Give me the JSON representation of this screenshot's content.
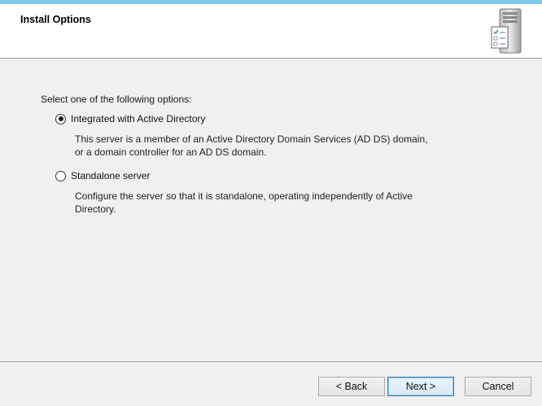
{
  "header": {
    "title": "Install Options",
    "icon": "server-checklist-icon"
  },
  "main": {
    "prompt": "Select one of the following options:",
    "options": [
      {
        "label": "Integrated with Active Directory",
        "selected": true,
        "description_lines": [
          "This server is a member of an Active Directory Domain Services (AD DS) domain,",
          "or a domain controller for an AD DS domain."
        ]
      },
      {
        "label": "Standalone server",
        "selected": false,
        "description_lines": [
          "Configure the server so that it is standalone, operating independently of Active",
          "Directory."
        ]
      }
    ]
  },
  "footer": {
    "back_label": "< Back",
    "next_label": "Next >",
    "cancel_label": "Cancel"
  },
  "colors": {
    "top_accent": "#7fc7e6",
    "header_bg": "#ffffff",
    "body_bg": "#f0f0f0",
    "default_button_border": "#3c7fb1"
  }
}
